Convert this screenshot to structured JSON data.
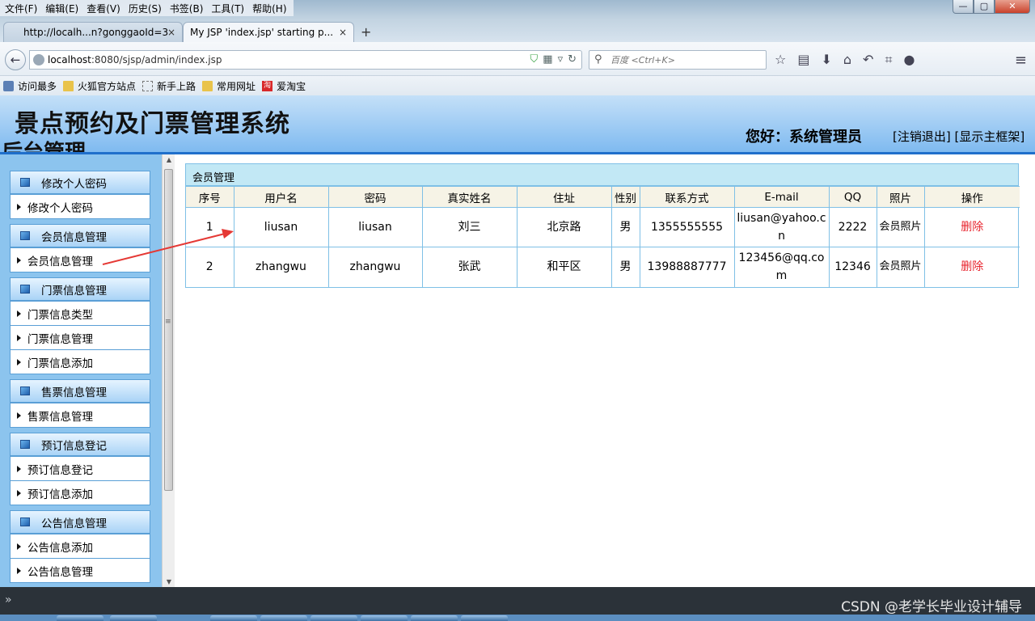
{
  "browser": {
    "menu": [
      "文件(F)",
      "编辑(E)",
      "查看(V)",
      "历史(S)",
      "书签(B)",
      "工具(T)",
      "帮助(H)"
    ],
    "window_controls": {
      "minimize": "—",
      "maximize": "▢",
      "close": "✕"
    },
    "tabs": [
      {
        "label": "http://localh...n?gonggaoId=3",
        "active": false
      },
      {
        "label": "My JSP 'index.jsp' starting p...",
        "active": true
      }
    ],
    "tab_close": "×",
    "new_tab": "+",
    "back": "←",
    "url_host": "localhost",
    "url_rest": ":8080/sjsp/admin/index.jsp",
    "search_placeholder": "百度 <Ctrl+K>",
    "bookmarks": [
      {
        "label": "访问最多",
        "icon": "rss-icon"
      },
      {
        "label": "火狐官方站点",
        "icon": "folder-icon"
      },
      {
        "label": "新手上路",
        "icon": "dashed-box-icon"
      },
      {
        "label": "常用网址",
        "icon": "folder-icon"
      },
      {
        "label": "爱淘宝",
        "icon": "taobao-icon"
      }
    ],
    "taobao_glyph": "淘"
  },
  "header": {
    "title": "景点预约及门票管理系统",
    "subtitle": "后台管理",
    "greeting": "您好：系统管理员",
    "links": [
      "[注销退出]",
      "[显示主框架]"
    ]
  },
  "sidebar": {
    "groups": [
      {
        "title": "修改个人密码",
        "items": [
          "修改个人密码"
        ]
      },
      {
        "title": "会员信息管理",
        "items": [
          "会员信息管理"
        ]
      },
      {
        "title": "门票信息管理",
        "items": [
          "门票信息类型",
          "门票信息管理",
          "门票信息添加"
        ]
      },
      {
        "title": "售票信息管理",
        "items": [
          "售票信息管理"
        ]
      },
      {
        "title": "预订信息登记",
        "items": [
          "预订信息登记",
          "预订信息添加"
        ]
      },
      {
        "title": "公告信息管理",
        "items": [
          "公告信息添加",
          "公告信息管理"
        ]
      }
    ]
  },
  "panel": {
    "title": "会员管理",
    "columns": [
      "序号",
      "用户名",
      "密码",
      "真实姓名",
      "住址",
      "性别",
      "联系方式",
      "E-mail",
      "QQ",
      "照片",
      "操作"
    ],
    "rows": [
      [
        "1",
        "liusan",
        "liusan",
        "刘三",
        "北京路",
        "男",
        "1355555555",
        "liusan@yahoo.cn",
        "2222",
        "会员照片",
        "删除"
      ],
      [
        "2",
        "zhangwu",
        "zhangwu",
        "张武",
        "和平区",
        "男",
        "13988887777",
        "123456@qq.com",
        "12346",
        "会员照片",
        "删除"
      ]
    ]
  },
  "statusbar": {
    "chevron": "»",
    "watermark": "CSDN @老学长毕业设计辅导"
  },
  "colors": {
    "header_gradient_top": "#c4e0f8",
    "header_gradient_bottom": "#7fbaf0",
    "header_rule": "#1f6fcb",
    "sidebar_bg": "#8cc4ee",
    "panel_title_bg": "#c2e8f5",
    "table_head_bg": "#f6f3e6",
    "delete_link": "#e8262f",
    "annotation_arrow": "#e53935"
  }
}
